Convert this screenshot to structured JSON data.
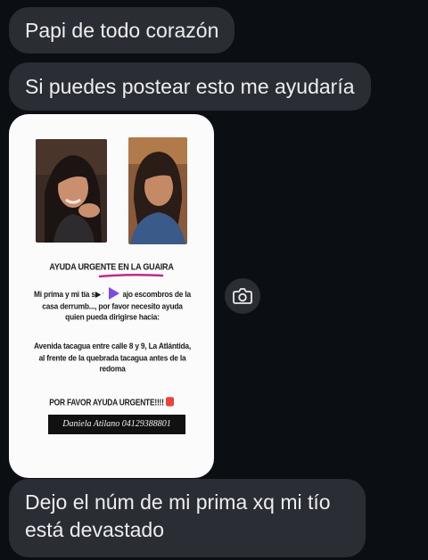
{
  "messages": [
    {
      "text": "Papi de todo corazón"
    },
    {
      "text": "Si puedes postear esto me ayudaría"
    },
    {
      "text": "Dejo el núm de mi prima xq mi tío está devastado"
    }
  ],
  "poster": {
    "heading": "AYUDA URGENTE EN LA GUAIRA",
    "body1": "Mi prima y mi tía s▶ tran bajo escombros de la casa derrumb..., por favor necesito ayuda quien pueda dirigirse hacia:",
    "body2": "Avenida tacagua entre calle 8 y 9, La Atlántida, al frente de la quebrada tacagua antes de la redoma",
    "urgent": "POR FAVOR AYUDA URGENTE!!!!",
    "contact": "Daniela Atilano 04129388801"
  },
  "icons": {
    "share": "camera-icon",
    "play": "play-icon"
  },
  "colors": {
    "background": "#0b0e13",
    "bubble": "#2a2d33",
    "accent_underline": "#c02a8c",
    "play": "#7b4de0"
  }
}
